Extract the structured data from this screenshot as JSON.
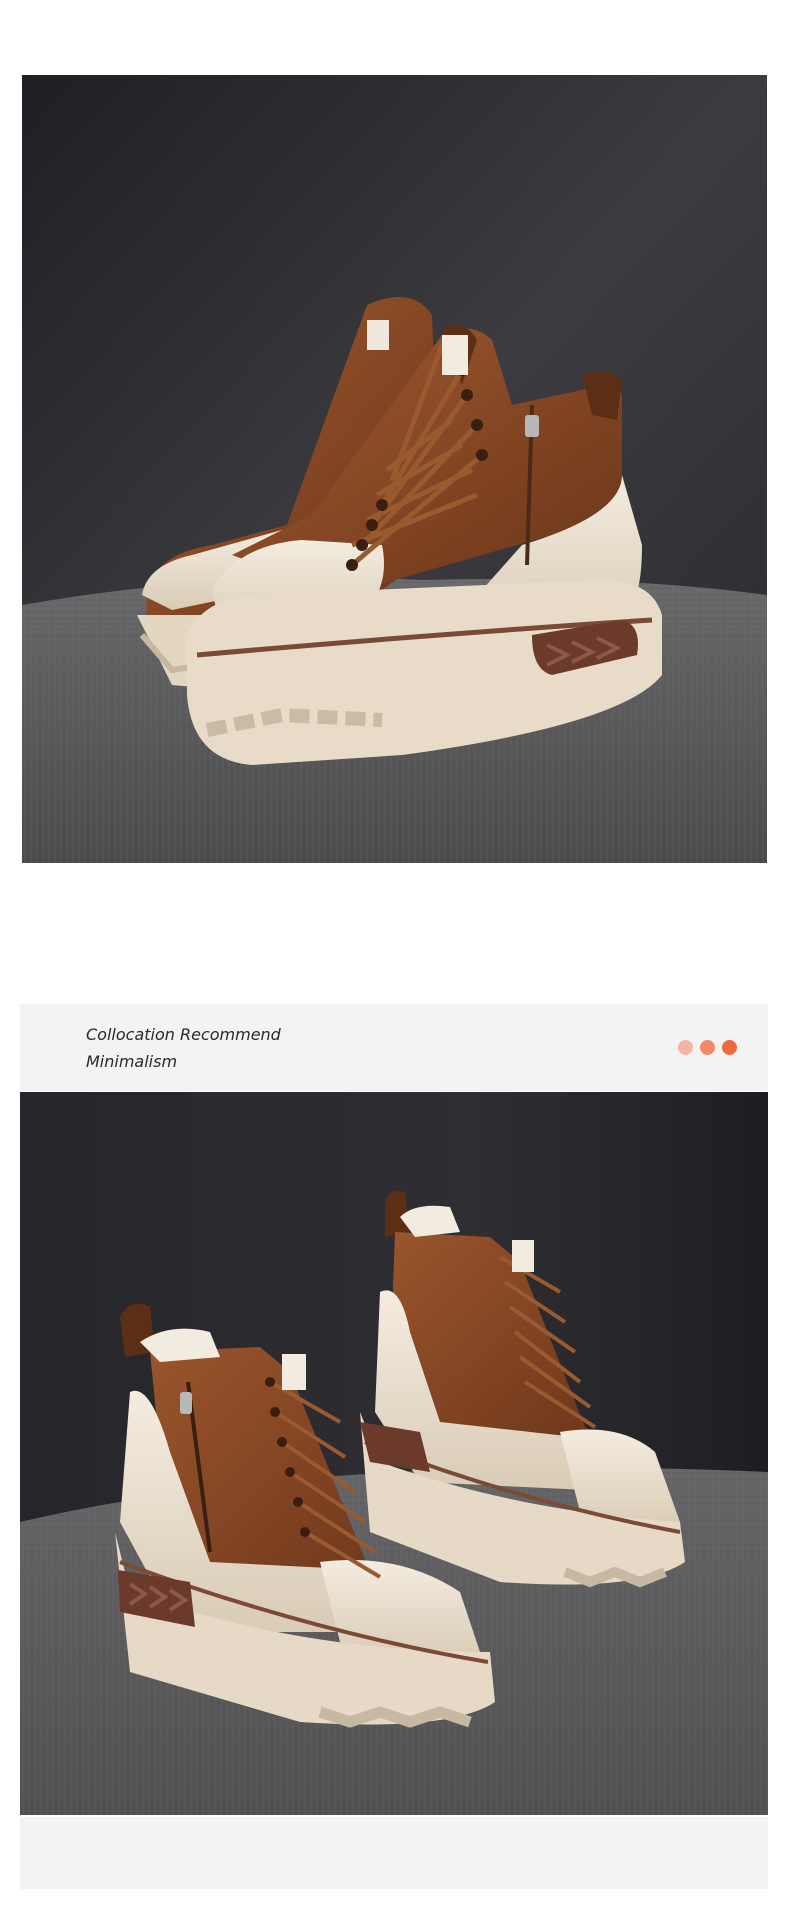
{
  "collocation": {
    "title": "Collocation Recommend",
    "subtitle": "Minimalism",
    "dot_colors": [
      "#f6b5a3",
      "#f08a6a",
      "#ec6a3e"
    ]
  },
  "palette": {
    "backdrop_dark": "#2a2a2e",
    "backdrop_light": "#4a4a4f",
    "seat_fabric": "#5a5a5c",
    "leather_brown": "#8a4a25",
    "leather_dark": "#5c2e16",
    "cream": "#eadfcf",
    "sole_cream": "#e6dac6",
    "sole_stripe": "#7a4a36",
    "lace": "#9a5a30"
  }
}
